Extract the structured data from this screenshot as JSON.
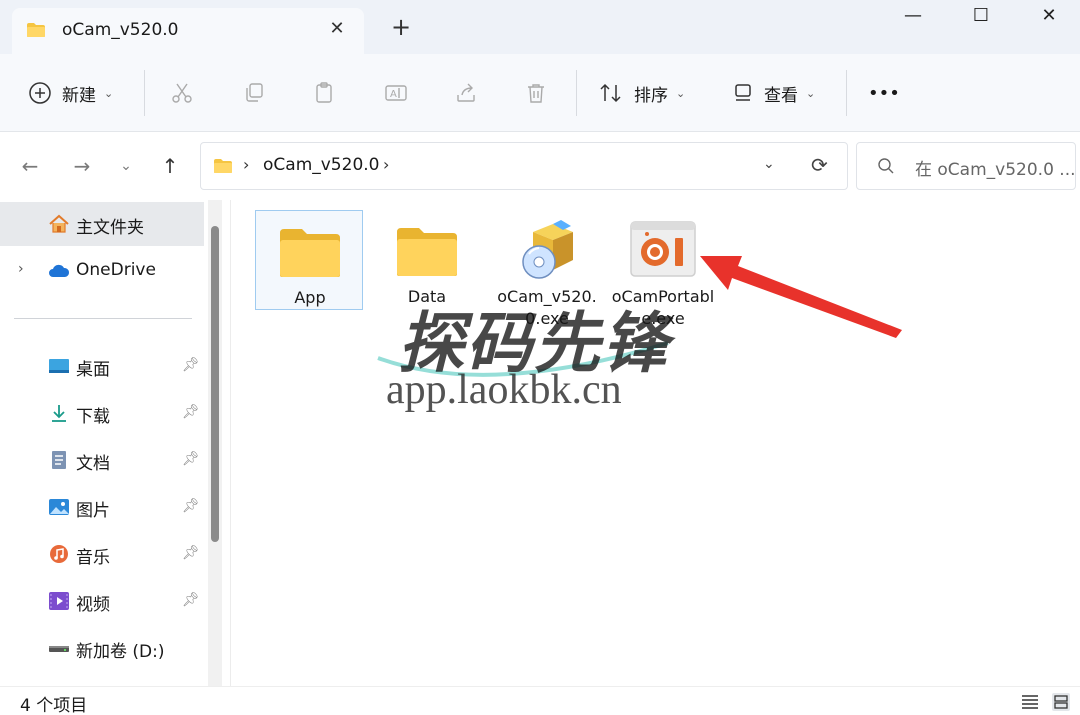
{
  "window": {
    "tab_title": "oCam_v520.0",
    "tab_close": "✕",
    "new_tab": "+",
    "minimize": "—",
    "maximize": "☐",
    "close": "✕"
  },
  "toolbar": {
    "new_label": "新建",
    "sort_label": "排序",
    "view_label": "查看",
    "more_label": "•••"
  },
  "address": {
    "path": "oCam_v520.0",
    "search_placeholder": "在 oCam_v520.0 ..."
  },
  "sidebar": {
    "home": "主文件夹",
    "onedrive": "OneDrive",
    "items": [
      {
        "label": "桌面",
        "icon": "desktop-icon"
      },
      {
        "label": "下载",
        "icon": "download-icon"
      },
      {
        "label": "文档",
        "icon": "document-icon"
      },
      {
        "label": "图片",
        "icon": "pictures-icon"
      },
      {
        "label": "音乐",
        "icon": "music-icon"
      },
      {
        "label": "视频",
        "icon": "video-icon"
      },
      {
        "label": "新加卷 (D:)",
        "icon": "drive-icon"
      }
    ]
  },
  "files": [
    {
      "name": "App",
      "icon": "folder-icon"
    },
    {
      "name": "Data",
      "icon": "folder-icon"
    },
    {
      "name": "oCam_v520.0.exe",
      "icon": "installer-icon"
    },
    {
      "name": "oCamPortable.exe",
      "icon": "ocam-icon"
    }
  ],
  "watermark": {
    "text": "探码先锋",
    "url": "app.laokbk.cn"
  },
  "status": {
    "count": "4 个项目"
  },
  "colors": {
    "accent": "#0067c0",
    "folder": "#f5c542",
    "arrow": "#e8322b"
  }
}
